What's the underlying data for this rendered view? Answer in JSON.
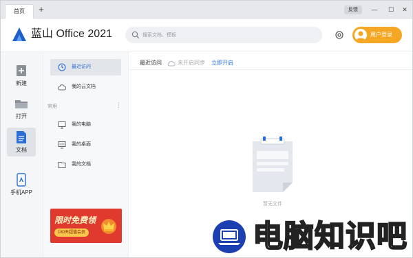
{
  "titlebar": {
    "tab_label": "首页",
    "new_tab_glyph": "+",
    "feedback_label": "反馈",
    "min_glyph": "—",
    "max_glyph": "☐",
    "close_glyph": "✕"
  },
  "header": {
    "app_title": "蓝山 Office 2021",
    "search_placeholder": "搜索文档、模板",
    "login_label": "用户登录"
  },
  "rail": {
    "items": [
      {
        "label": "新建",
        "icon": "new-doc-icon"
      },
      {
        "label": "打开",
        "icon": "folder-icon"
      },
      {
        "label": "文档",
        "icon": "document-icon",
        "active": true
      },
      {
        "label": "手机APP",
        "icon": "phone-icon"
      }
    ]
  },
  "nav": {
    "items": [
      {
        "label": "最近访问",
        "icon": "clock-icon",
        "active": true
      },
      {
        "label": "我的云文档",
        "icon": "cloud-icon"
      }
    ],
    "section_title": "常用",
    "section_more": "⋮",
    "common_items": [
      {
        "label": "我的电脑",
        "icon": "computer-icon"
      },
      {
        "label": "我的桌面",
        "icon": "desktop-icon"
      },
      {
        "label": "我的文档",
        "icon": "folder-doc-icon"
      }
    ],
    "promo": {
      "title": "限时免费领",
      "subtitle": "180天超值会员"
    }
  },
  "main": {
    "tab_recent": "最近访问",
    "sync_status": "未开启同步",
    "sync_link": "立即开启",
    "empty_text": "暂无文件"
  },
  "watermark": {
    "text": "电脑知识吧"
  },
  "colors": {
    "accent": "#2b6fd6",
    "login": "#f5a623",
    "promo": "#e03a2e"
  }
}
